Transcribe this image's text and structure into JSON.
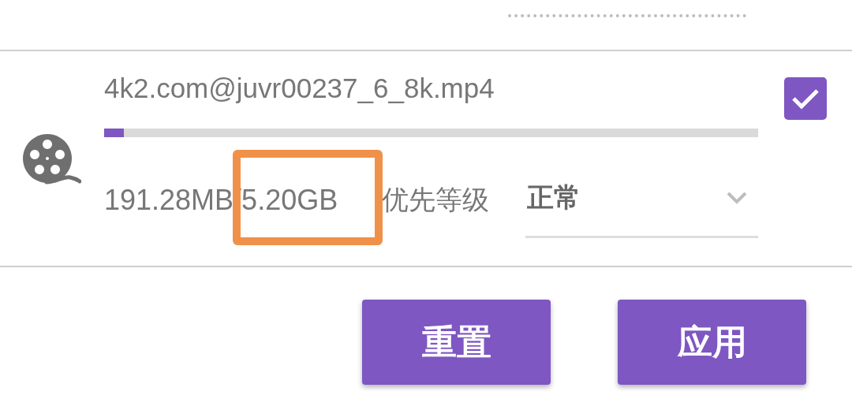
{
  "item": {
    "filename": "4k2.com@juvr00237_6_8k.mp4",
    "level": 0.03,
    "size": "191.28MB/5.20GB",
    "priority_label": "优先等级",
    "priority_value": "正常",
    "checked": true
  },
  "buttons": [
    {
      "label": "重置"
    },
    {
      "label": "应用"
    }
  ]
}
